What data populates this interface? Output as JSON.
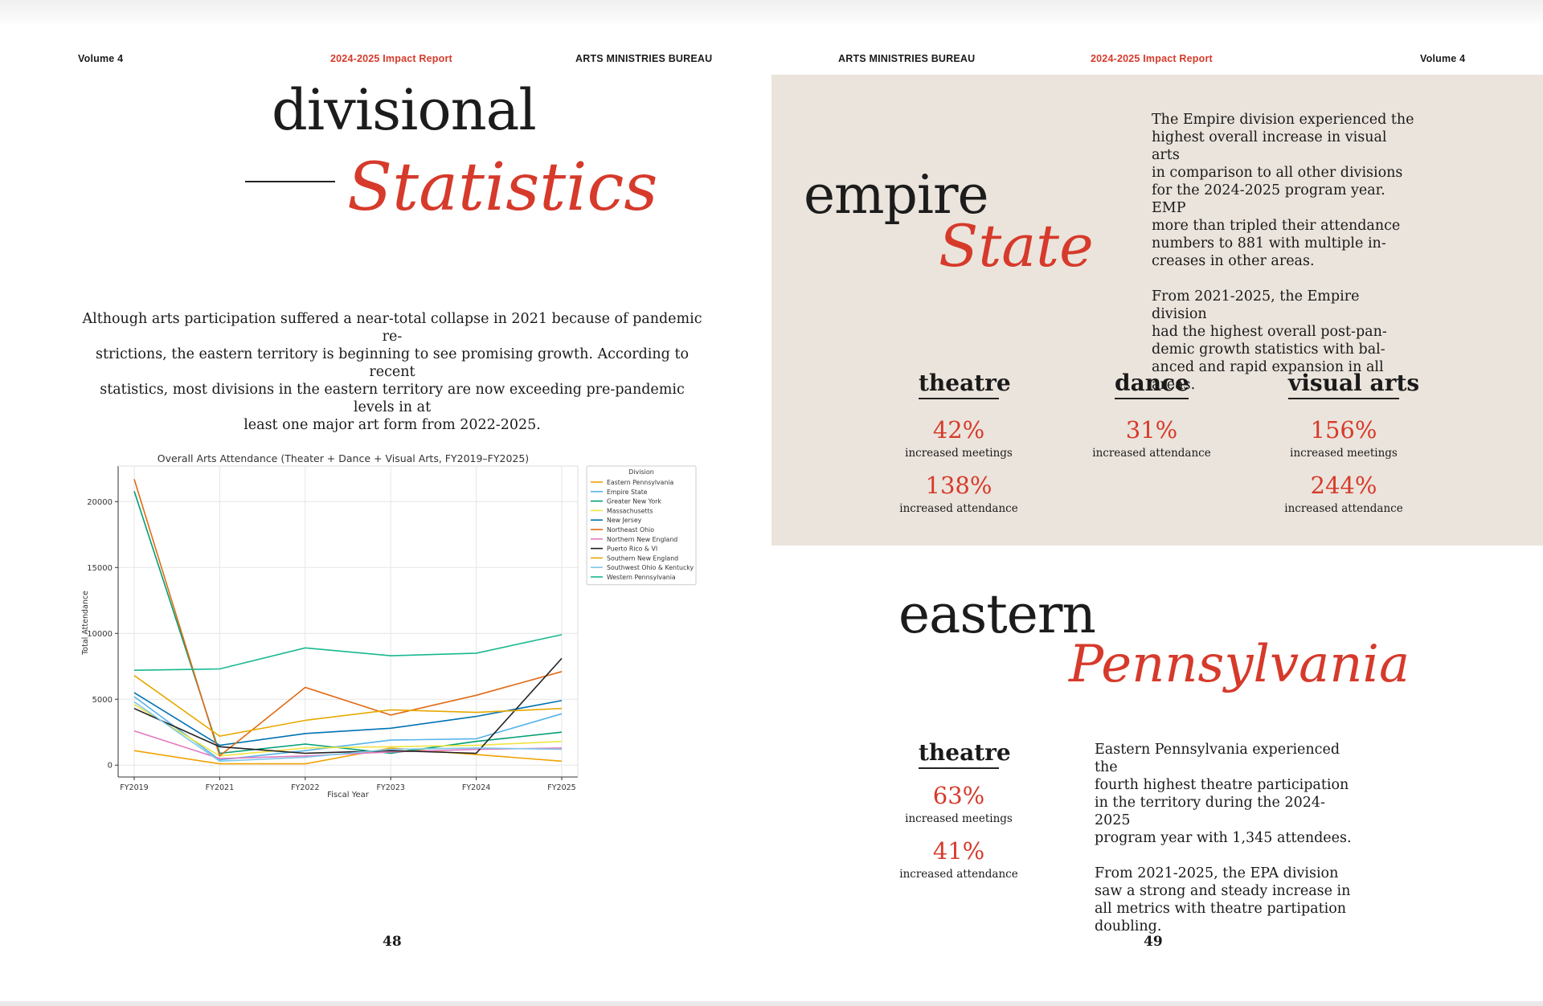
{
  "header": {
    "left_volume": "Volume 4",
    "left_report": "2024-2025 Impact Report",
    "left_org": "ARTS MINISTRIES BUREAU",
    "right_org": "ARTS MINISTRIES BUREAU",
    "right_report": "2024-2025 Impact Report",
    "right_volume": "Volume 4"
  },
  "left_page": {
    "title_serif": "divisional",
    "title_script": "Statistics",
    "intro_lines": [
      "Although arts participation suffered a near-total collapse in 2021 because of pandemic re-",
      "strictions, the eastern territory is beginning to see promising growth. According to recent",
      "statistics, most divisions in the eastern territory are now exceeding pre-pandemic levels in at",
      "least one major art form from 2022-2025."
    ],
    "page_number": "48"
  },
  "chart_data": {
    "type": "line",
    "title": "Overall Arts Attendance (Theater + Dance + Visual Arts, FY2019–FY2025)",
    "xlabel": "Fiscal Year",
    "ylabel": "Total Attendance",
    "x": [
      "FY2019",
      "FY2021",
      "FY2022",
      "FY2023",
      "FY2024",
      "FY2025"
    ],
    "yticks": [
      "0",
      "5000",
      "10000",
      "15000",
      "20000"
    ],
    "ylim": [
      -900,
      22700
    ],
    "grid": true,
    "legend_title": "Division",
    "legend_position": "upper-right",
    "series": [
      {
        "name": "Eastern Pennsylvania",
        "color": "#f0a202",
        "values": [
          1100,
          100,
          100,
          1300,
          800,
          300
        ]
      },
      {
        "name": "Empire State",
        "color": "#56b4e9",
        "values": [
          5200,
          400,
          1100,
          1900,
          2000,
          3900
        ]
      },
      {
        "name": "Greater New York",
        "color": "#009e73",
        "values": [
          20800,
          900,
          1600,
          900,
          1800,
          2500
        ]
      },
      {
        "name": "Massachusetts",
        "color": "#f0e442",
        "values": [
          4600,
          700,
          1300,
          1400,
          1500,
          1800
        ]
      },
      {
        "name": "New Jersey",
        "color": "#0072b2",
        "values": [
          5500,
          1500,
          2400,
          2800,
          3700,
          4900
        ]
      },
      {
        "name": "Northeast Ohio",
        "color": "#e06b16",
        "values": [
          21700,
          700,
          5900,
          3800,
          5300,
          7100
        ]
      },
      {
        "name": "Northern New England",
        "color": "#e377c2",
        "values": [
          2600,
          500,
          700,
          1000,
          1200,
          1300
        ]
      },
      {
        "name": "Puerto Rico & VI",
        "color": "#222222",
        "values": [
          4300,
          1400,
          900,
          1100,
          900,
          8100
        ]
      },
      {
        "name": "Southern New England",
        "color": "#e6a800",
        "values": [
          6800,
          2200,
          3400,
          4200,
          4000,
          4300
        ]
      },
      {
        "name": "Southwest Ohio & Kentucky",
        "color": "#7fc8e8",
        "values": [
          4800,
          300,
          600,
          1200,
          1300,
          1200
        ]
      },
      {
        "name": "Western Pennsylvania",
        "color": "#17b890",
        "values": [
          7200,
          7300,
          8900,
          8300,
          8500,
          9900
        ]
      }
    ]
  },
  "right_page": {
    "empire": {
      "title_serif": "empire",
      "title_script": "State",
      "para1": [
        "The Empire division experienced the",
        "highest overall increase in visual arts",
        "in comparison to all other divisions",
        "for the 2024-2025 program year. EMP",
        "more than tripled their attendance",
        "numbers to 881 with multiple in-",
        "creases in other areas."
      ],
      "para2": [
        "From 2021-2025, the Empire division",
        "had the highest overall post-pan-",
        "demic growth statistics with bal-",
        "anced and rapid expansion in all",
        "areas."
      ],
      "theatre": {
        "heading": "theatre",
        "pct1": "42%",
        "lbl1": "increased meetings",
        "pct2": "138%",
        "lbl2": "increased attendance"
      },
      "dance": {
        "heading": "dance",
        "pct1": "31%",
        "lbl1": "increased attendance"
      },
      "visual": {
        "heading": "visual arts",
        "pct1": "156%",
        "lbl1": "increased meetings",
        "pct2": "244%",
        "lbl2": "increased attendance"
      }
    },
    "eastern": {
      "title_serif": "eastern",
      "title_script": "Pennsylvania",
      "theatre": {
        "heading": "theatre",
        "pct1": "63%",
        "lbl1": "increased meetings",
        "pct2": "41%",
        "lbl2": "increased attendance"
      },
      "para1": [
        "Eastern Pennsylvania experienced the",
        "fourth highest theatre participation",
        "in the territory during the 2024-2025",
        "program year with 1,345 attendees."
      ],
      "para2": [
        "From 2021-2025, the EPA division",
        "saw a strong and steady increase in",
        "all metrics with theatre partipation",
        "doubling."
      ]
    },
    "page_number": "49"
  },
  "colors": {
    "accent_red": "#d63a2b",
    "beige_panel": "#ebe4dc",
    "text": "#1a1a1a"
  }
}
